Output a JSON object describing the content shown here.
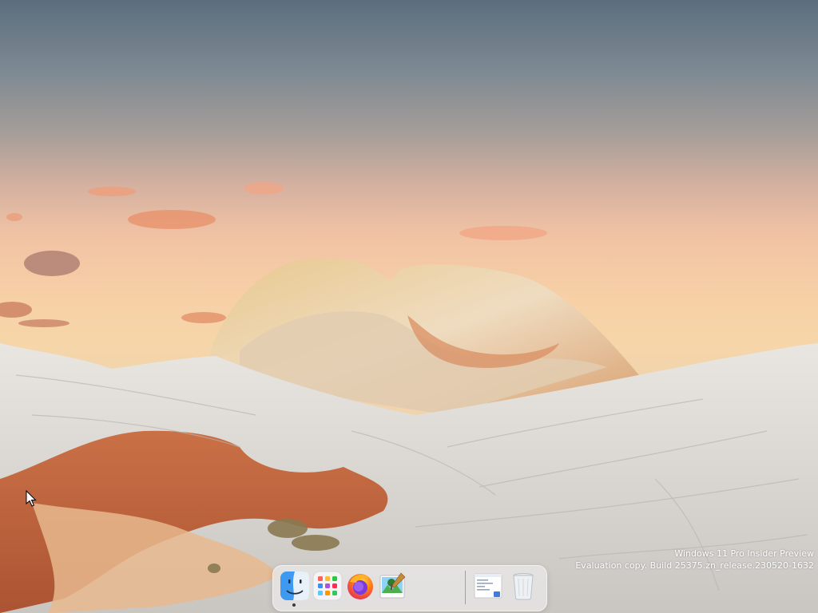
{
  "watermark": {
    "line1": "Windows 11 Pro Insider Preview",
    "line2": "Evaluation copy. Build 25375.zn_release.230520-1632"
  },
  "dock": {
    "apps": [
      {
        "name": "Finder",
        "icon": "finder-icon",
        "running": true
      },
      {
        "name": "Launchpad",
        "icon": "launchpad-icon",
        "running": false
      },
      {
        "name": "Firefox",
        "icon": "firefox-icon",
        "running": false
      },
      {
        "name": "Preview",
        "icon": "preview-icon",
        "running": false
      }
    ],
    "others": [
      {
        "name": "Document",
        "icon": "document-icon"
      },
      {
        "name": "Trash",
        "icon": "trash-icon"
      }
    ]
  },
  "colors": {
    "sky_top": "#5b6e7e",
    "sky_horizon": "#f6d6a9",
    "rock": "#d9d6d0",
    "sand_red": "#b9552c"
  }
}
